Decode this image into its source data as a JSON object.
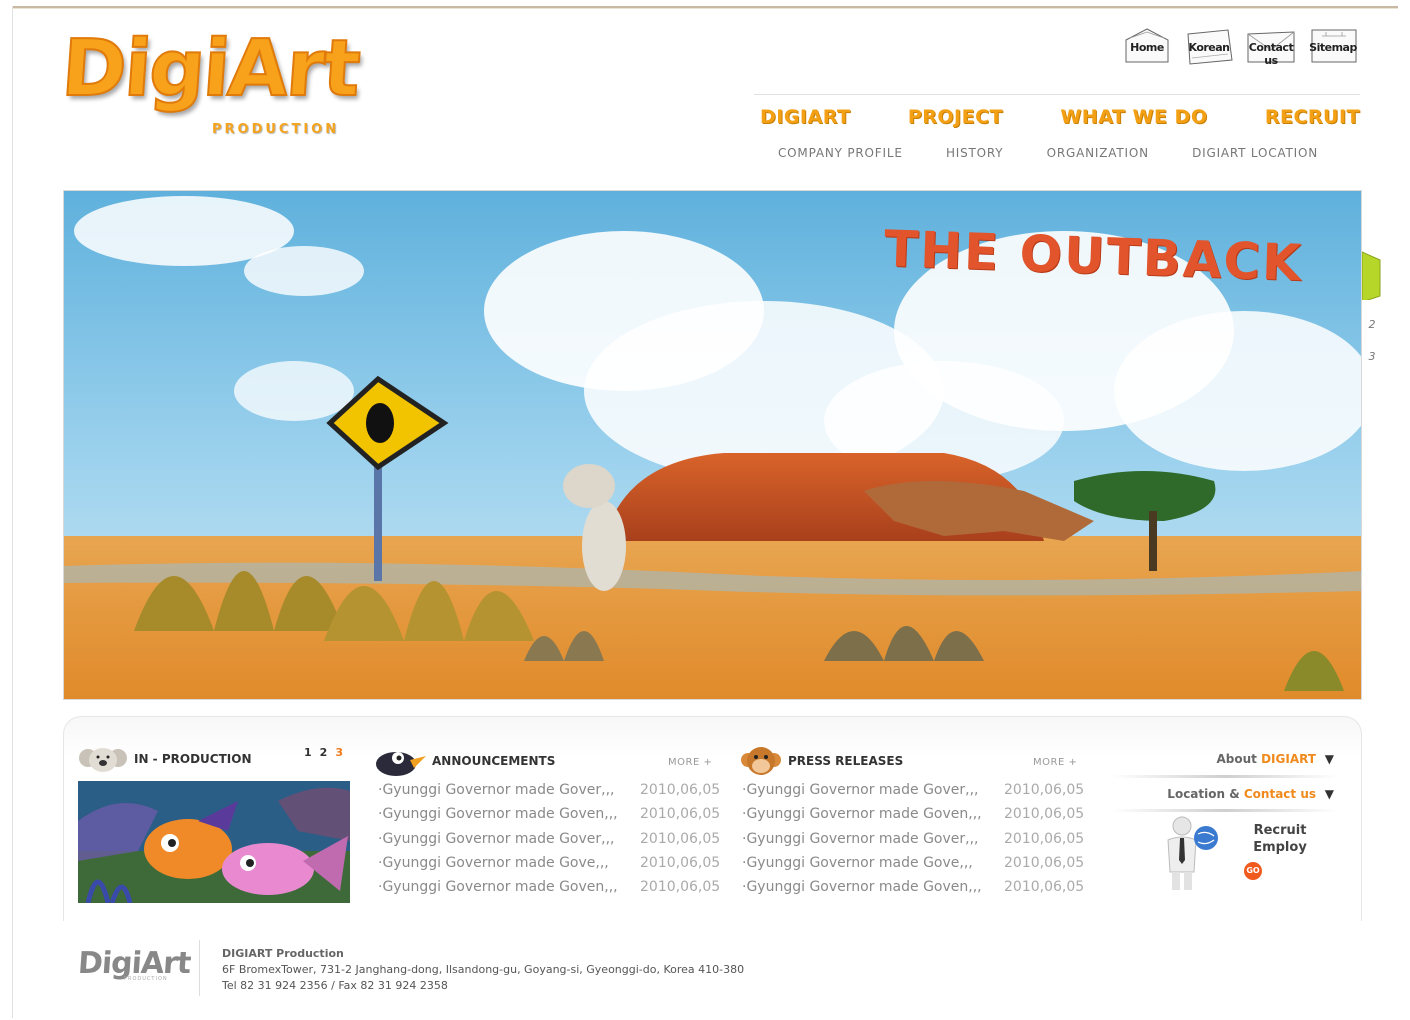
{
  "logo": {
    "word": "DigiArt",
    "sub": "PRODUCTION"
  },
  "utility_links": [
    {
      "label": "Home"
    },
    {
      "label": "Korean"
    },
    {
      "label": "Contact us"
    },
    {
      "label": "Sitemap"
    }
  ],
  "nav": {
    "main": [
      "DIGIART",
      "PROJECT",
      "WHAT WE DO",
      "RECRUIT"
    ],
    "sub": [
      "COMPANY PROFILE",
      "HISTORY",
      "ORGANIZATION",
      "DIGIART LOCATION"
    ]
  },
  "hero": {
    "title": "THE OUTBACK",
    "slide_tabs": [
      "2",
      "3"
    ]
  },
  "in_production": {
    "title": "IN - PRODUCTION",
    "pages": [
      "1",
      "2",
      "3"
    ],
    "active_page": "3"
  },
  "announcements": {
    "title": "ANNOUNCEMENTS",
    "more": "MORE +",
    "items": [
      {
        "title": "·Gyunggi Governor made Gover,,,",
        "date": "2010,06,05"
      },
      {
        "title": "·Gyunggi Governor made Goven,,,",
        "date": "2010,06,05"
      },
      {
        "title": "·Gyunggi Governor made Gover,,,",
        "date": "2010,06,05"
      },
      {
        "title": "·Gyunggi Governor made Gove,,,",
        "date": "2010,06,05"
      },
      {
        "title": "·Gyunggi Governor made Goven,,,",
        "date": "2010,06,05"
      }
    ]
  },
  "press_releases": {
    "title": "PRESS RELEASES",
    "more": "MORE +",
    "items": [
      {
        "title": "·Gyunggi Governor made Gover,,,",
        "date": "2010,06,05"
      },
      {
        "title": "·Gyunggi Governor made Goven,,,",
        "date": "2010,06,05"
      },
      {
        "title": "·Gyunggi Governor made Gover,,,",
        "date": "2010,06,05"
      },
      {
        "title": "·Gyunggi Governor made Gove,,,",
        "date": "2010,06,05"
      },
      {
        "title": "·Gyunggi Governor made Goven,,,",
        "date": "2010,06,05"
      }
    ]
  },
  "right_column": {
    "about_prefix": "About ",
    "about_highlight": "DIGIART",
    "location_prefix": "Location & ",
    "location_highlight": "Contact us",
    "recruit_line1": "Recruit",
    "recruit_line2": "Employ",
    "go": "GO"
  },
  "footer": {
    "logo": "DigiArt",
    "logo_sub": "PRODUCTION",
    "company": "DIGIART Production",
    "address": "6F BromexTower, 731-2 Janghang-dong, Ilsandong-gu, Goyang-si, Gyeonggi-do, Korea 410-380",
    "phone": "Tel 82 31 924 2356 / Fax 82 31 924 2358"
  },
  "colors": {
    "brand_orange": "#f3a014",
    "accent_red": "#f05a1e",
    "title_red": "#e2542b"
  }
}
